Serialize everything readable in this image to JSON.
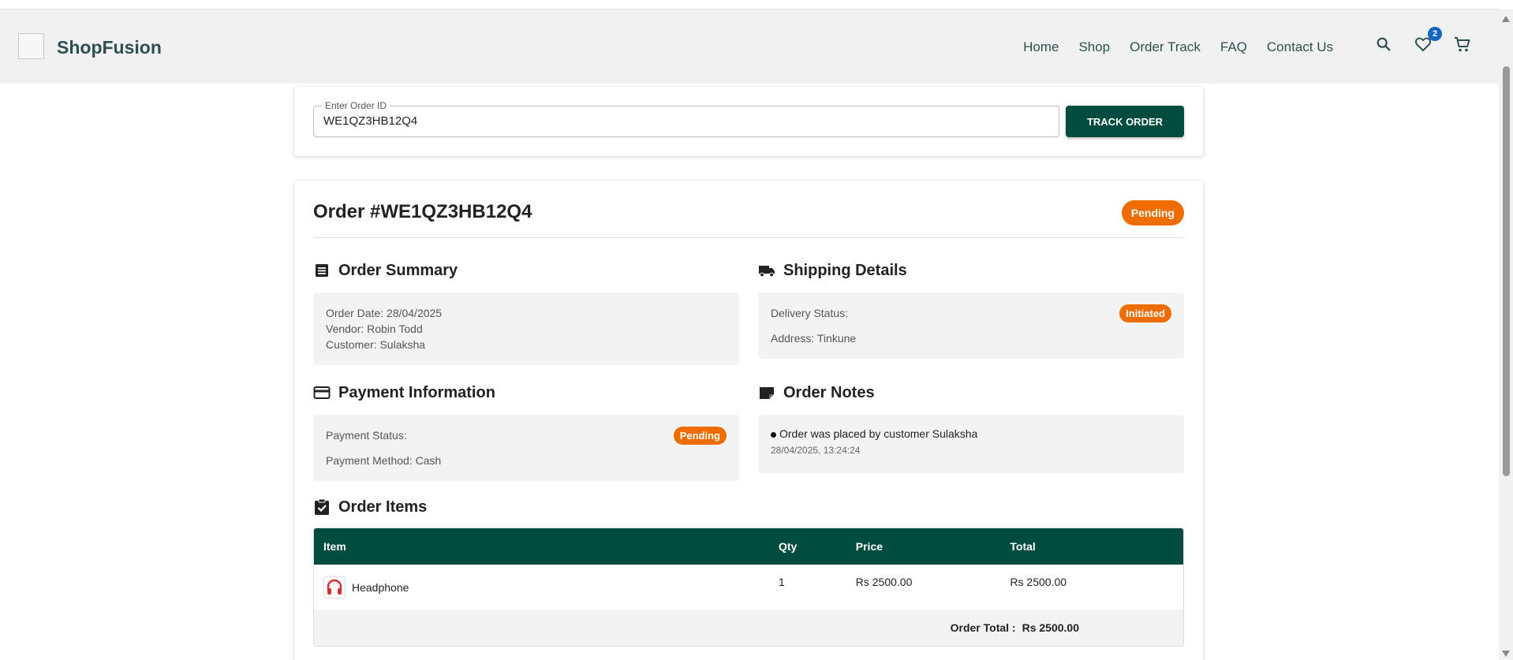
{
  "header": {
    "brand": "ShopFusion",
    "nav": [
      "Home",
      "Shop",
      "Order Track",
      "FAQ",
      "Contact Us"
    ],
    "wishlist_count": "2",
    "icons": [
      "search-icon",
      "heart-icon",
      "cart-icon"
    ]
  },
  "search": {
    "label": "Enter Order ID",
    "value": "WE1QZ3HB12Q4",
    "button": "TRACK ORDER"
  },
  "order": {
    "title": "Order #WE1QZ3HB12Q4",
    "status": "Pending",
    "summary": {
      "title": "Order Summary",
      "date": "Order Date: 28/04/2025",
      "vendor": "Vendor: Robin Todd",
      "customer": "Customer: Sulaksha"
    },
    "shipping": {
      "title": "Shipping Details",
      "delivery_label": "Delivery Status:",
      "delivery_status": "Initiated",
      "address": "Address: Tinkune"
    },
    "payment": {
      "title": "Payment Information",
      "status_label": "Payment Status:",
      "status": "Pending",
      "method": "Payment Method: Cash"
    },
    "notes": {
      "title": "Order Notes",
      "text": "Order was placed by customer Sulaksha",
      "time": "28/04/2025, 13:24:24"
    },
    "items": {
      "title": "Order Items",
      "columns": [
        "Item",
        "Qty",
        "Price",
        "Total"
      ],
      "rows": [
        {
          "name": "Headphone",
          "qty": "1",
          "price": "Rs 2500.00",
          "total": "Rs 2500.00"
        }
      ],
      "order_total_label": "Order Total :",
      "order_total": "Rs 2500.00"
    }
  },
  "colors": {
    "primary": "#004d40",
    "status_orange": "#ef6c00",
    "badge_blue": "#1565c0",
    "brand_text": "#2f4f4f"
  }
}
